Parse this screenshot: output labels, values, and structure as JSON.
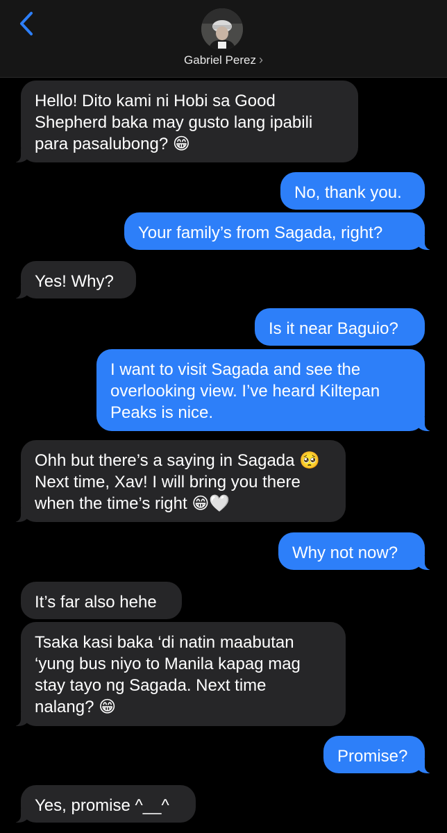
{
  "header": {
    "back_icon": "chevron-left-icon",
    "contact_name": "Gabriel Perez",
    "chevron": "›",
    "accent": "#2d7ff9"
  },
  "messages": [
    {
      "dir": "in",
      "text": "Hello! Dito kami ni Hobi sa Good\nShepherd baka may gusto lang ipabili\npara pasalubong? 😁"
    },
    {
      "dir": "out",
      "text": "No, thank you."
    },
    {
      "dir": "out",
      "text": "Your family’s from Sagada, right?"
    },
    {
      "dir": "in",
      "text": "Yes! Why?"
    },
    {
      "dir": "out",
      "text": "Is it near Baguio?"
    },
    {
      "dir": "out",
      "text": "I want to visit Sagada and see the\noverlooking view. I’ve heard Kiltepan\nPeaks is nice."
    },
    {
      "dir": "in",
      "text": "Ohh but there’s a saying in Sagada 🥺\nNext time, Xav! I will bring you there\nwhen the time’s right 😁🤍"
    },
    {
      "dir": "out",
      "text": "Why not now?"
    },
    {
      "dir": "in",
      "text": "It’s far also hehe"
    },
    {
      "dir": "in",
      "text": "Tsaka kasi baka ‘di natin maabutan\n‘yung bus niyo to Manila kapag mag\nstay tayo ng Sagada. Next time\nnalang? 😁"
    },
    {
      "dir": "out",
      "text": "Promise?"
    },
    {
      "dir": "in",
      "text": "Yes, promise ^__^"
    }
  ],
  "colors": {
    "incoming_bubble": "#262628",
    "outgoing_bubble": "#2d7ff9",
    "background": "#000000",
    "header_bg": "#161616"
  }
}
